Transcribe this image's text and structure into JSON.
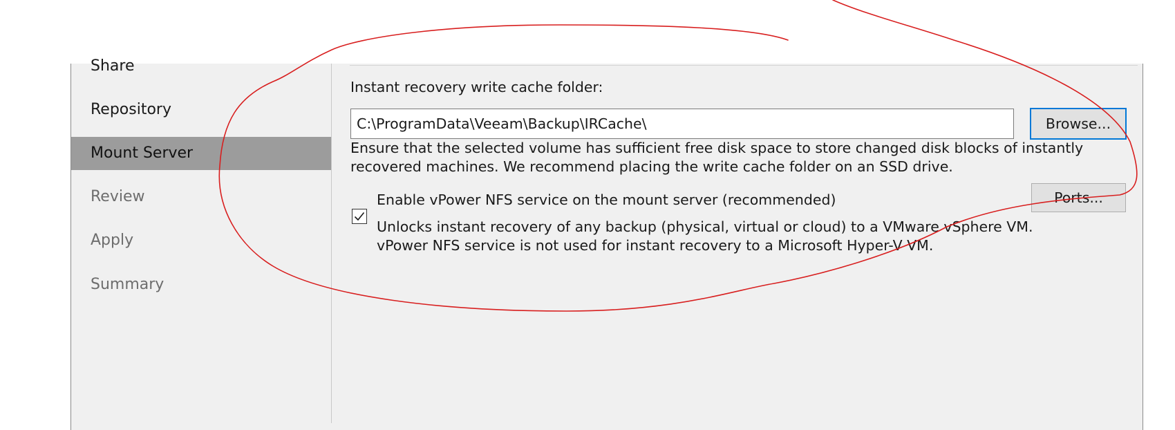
{
  "sidebar": {
    "items": [
      {
        "label": "Share",
        "state": "done"
      },
      {
        "label": "Repository",
        "state": "done"
      },
      {
        "label": "Mount Server",
        "state": "active"
      },
      {
        "label": "Review",
        "state": "pending"
      },
      {
        "label": "Apply",
        "state": "pending"
      },
      {
        "label": "Summary",
        "state": "pending"
      }
    ]
  },
  "mount_server": {
    "cache_folder_label": "Instant recovery write cache folder:",
    "cache_folder_value": "C:\\ProgramData\\Veeam\\Backup\\IRCache\\",
    "browse_label": "Browse...",
    "hint_line1": "Ensure that the selected volume has sufficient free disk space to store changed disk blocks of instantly",
    "hint_line2": "recovered machines. We recommend placing the write cache folder on an SSD drive.",
    "nfs_checkbox_label": "Enable vPower NFS service on the mount server (recommended)",
    "nfs_checked": true,
    "ports_label": "Ports...",
    "nfs_desc_line1": "Unlocks instant recovery of any backup (physical, virtual or cloud) to a VMware vSphere VM.",
    "nfs_desc_line2": "vPower NFS service is not used for instant recovery to a Microsoft Hyper-V VM."
  },
  "colors": {
    "panel_bg": "#f0f0f0",
    "active_nav_bg": "#9c9c9c",
    "focus_border": "#0078d7",
    "annotation_stroke": "#d81e1e"
  }
}
